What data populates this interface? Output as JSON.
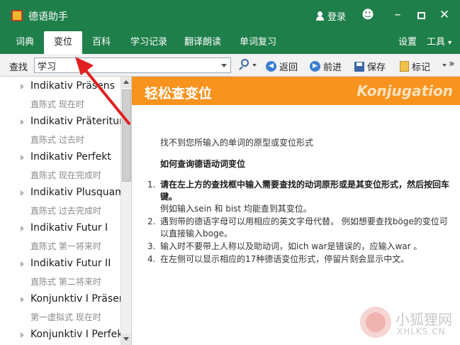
{
  "window": {
    "title": "德语助手",
    "login_label": "登录",
    "icons": [
      "app-icon",
      "person-icon",
      "smiley-icon",
      "minimize-icon",
      "maximize-icon",
      "close-icon"
    ]
  },
  "menu": {
    "tabs": [
      {
        "label": "词典",
        "active": false
      },
      {
        "label": "变位",
        "active": true
      },
      {
        "label": "百科",
        "active": false
      },
      {
        "label": "学习记录",
        "active": false
      },
      {
        "label": "翻译朗读",
        "active": false
      },
      {
        "label": "单词复习",
        "active": false
      }
    ],
    "settings_label": "设置",
    "tools_label": "工具",
    "tools_caret": "▾"
  },
  "toolbar": {
    "search_label": "查找",
    "search_value": "学习",
    "back_label": "返回",
    "forward_label": "前进",
    "save_label": "保存",
    "mark_label": "标记",
    "overflow_label": "»"
  },
  "sidebar": {
    "items": [
      {
        "title": "Indikativ Präsens",
        "subtitle": "直陈式 现在时"
      },
      {
        "title": "Indikativ Präteritum",
        "subtitle": "直陈式 过去时"
      },
      {
        "title": "Indikativ Perfekt",
        "subtitle": "直陈式 现在完成时"
      },
      {
        "title": "Indikativ Plusquamperfekt",
        "subtitle": "直陈式 过去完成时"
      },
      {
        "title": "Indikativ Futur I",
        "subtitle": "直陈式 第一将来时"
      },
      {
        "title": "Indikativ Futur II",
        "subtitle": "直陈式 第二将来时"
      },
      {
        "title": "Konjunktiv I Präsens",
        "subtitle": "第一虚拟式 现在时"
      },
      {
        "title": "Konjunktiv I Perfekt",
        "subtitle": ""
      }
    ]
  },
  "content": {
    "banner_title": "轻松查变位",
    "banner_subtitle": "Konjugation",
    "banner_color": "#f7931e",
    "not_found": "找不到您所输入的单词的原型或变位形式",
    "howto_title": "如何查询德语动词变位",
    "steps": [
      {
        "num": "1.",
        "bold": "请在左上方的查找框中输入需要查找的动词原形或是其变位形式，然后按回车键。",
        "text": "例如输入sein 和 bist 均能查到其变位。"
      },
      {
        "num": "2.",
        "bold": "",
        "text": "遇到带的德语字母可以用相应的英文字母代替。 例如想要查找böge的变位可以直接输入boge。"
      },
      {
        "num": "3.",
        "bold": "",
        "text": "输入时不要带上人称以及助动词，如ich war是错误的，应输入war 。"
      },
      {
        "num": "4.",
        "bold": "",
        "text": "在左侧可以显示相应的17种德语变位形式，停留片刻会显示中文。"
      }
    ]
  },
  "watermark": {
    "text": "小狐狸网",
    "sub": "XHLKS.CN"
  },
  "theme": {
    "brand_green": "#1f7f4a",
    "accent_orange": "#f7931e",
    "arrow_red": "#e02020"
  }
}
